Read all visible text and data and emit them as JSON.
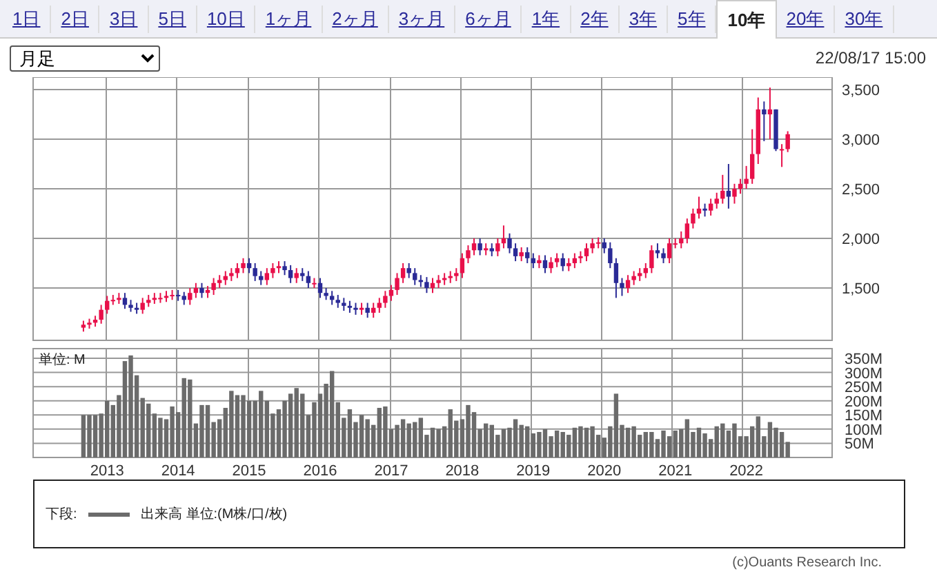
{
  "tabs": [
    {
      "label": "1日",
      "selected": false
    },
    {
      "label": "2日",
      "selected": false
    },
    {
      "label": "3日",
      "selected": false
    },
    {
      "label": "5日",
      "selected": false
    },
    {
      "label": "10日",
      "selected": false
    },
    {
      "label": "1ヶ月",
      "selected": false
    },
    {
      "label": "2ヶ月",
      "selected": false
    },
    {
      "label": "3ヶ月",
      "selected": false
    },
    {
      "label": "6ヶ月",
      "selected": false
    },
    {
      "label": "1年",
      "selected": false
    },
    {
      "label": "2年",
      "selected": false
    },
    {
      "label": "3年",
      "selected": false
    },
    {
      "label": "5年",
      "selected": false
    },
    {
      "label": "10年",
      "selected": true
    },
    {
      "label": "20年",
      "selected": false
    },
    {
      "label": "30年",
      "selected": false
    }
  ],
  "period_select": {
    "value": "月足"
  },
  "timestamp": "22/08/17 15:00",
  "price_chart": {
    "chart_data": {
      "type": "candlestick",
      "grid": true,
      "ylim": [
        972,
        3625
      ],
      "yticks": [
        {
          "value": 1500,
          "label": "1,500"
        },
        {
          "value": 2000,
          "label": "2,000"
        },
        {
          "value": 2500,
          "label": "2,500"
        },
        {
          "value": 3000,
          "label": "3,000"
        },
        {
          "value": 3500,
          "label": "3,500"
        }
      ],
      "categories": [
        null,
        null,
        null,
        null,
        null,
        null,
        null,
        null,
        null,
        null,
        null,
        null,
        null,
        null,
        null,
        null,
        null,
        null,
        null,
        null,
        null,
        null,
        null,
        null,
        null,
        null,
        null,
        null,
        null,
        null,
        null,
        null,
        null,
        null,
        null,
        null,
        null,
        null,
        null,
        null,
        null,
        null,
        null,
        null,
        null,
        null,
        null,
        null,
        null,
        null,
        null,
        null,
        null,
        null,
        null,
        null,
        null,
        null,
        null,
        null,
        null,
        null,
        null,
        null,
        null,
        null,
        null,
        null,
        null,
        null,
        null,
        null,
        null,
        null,
        null,
        null,
        null,
        null,
        null,
        null,
        null,
        null,
        null,
        null,
        null,
        null,
        null,
        null,
        null,
        null,
        null,
        null,
        null,
        null,
        null,
        null,
        null,
        null,
        null,
        null,
        null,
        null,
        null,
        null,
        null,
        null,
        null,
        null,
        null,
        null,
        null,
        null,
        null,
        null,
        null,
        null,
        null,
        null,
        null,
        null,
        null,
        null,
        null,
        null,
        null,
        null,
        null,
        null,
        null,
        null,
        null,
        null,
        null,
        null,
        null
      ],
      "ohlc": [
        null,
        null,
        null,
        null,
        null,
        null,
        null,
        null,
        [
          1100,
          1170,
          1060,
          1130
        ],
        [
          1130,
          1190,
          1090,
          1150
        ],
        [
          1150,
          1220,
          1110,
          1180
        ],
        [
          1180,
          1330,
          1140,
          1280
        ],
        [
          1280,
          1420,
          1240,
          1370
        ],
        [
          1370,
          1430,
          1330,
          1380
        ],
        [
          1380,
          1450,
          1340,
          1400
        ],
        [
          1400,
          1450,
          1290,
          1330
        ],
        [
          1330,
          1380,
          1260,
          1300
        ],
        [
          1300,
          1350,
          1240,
          1280
        ],
        [
          1280,
          1400,
          1240,
          1350
        ],
        [
          1350,
          1430,
          1310,
          1380
        ],
        [
          1380,
          1450,
          1340,
          1400
        ],
        [
          1400,
          1450,
          1350,
          1400
        ],
        [
          1400,
          1470,
          1360,
          1420
        ],
        [
          1420,
          1480,
          1380,
          1430
        ],
        [
          1430,
          1480,
          1370,
          1420
        ],
        [
          1420,
          1460,
          1330,
          1380
        ],
        [
          1380,
          1500,
          1330,
          1450
        ],
        [
          1450,
          1550,
          1400,
          1500
        ],
        [
          1500,
          1550,
          1400,
          1450
        ],
        [
          1450,
          1520,
          1400,
          1480
        ],
        [
          1480,
          1600,
          1430,
          1550
        ],
        [
          1550,
          1630,
          1500,
          1580
        ],
        [
          1580,
          1670,
          1530,
          1620
        ],
        [
          1620,
          1700,
          1570,
          1650
        ],
        [
          1650,
          1750,
          1600,
          1700
        ],
        [
          1700,
          1800,
          1650,
          1750
        ],
        [
          1750,
          1800,
          1650,
          1700
        ],
        [
          1700,
          1750,
          1570,
          1620
        ],
        [
          1620,
          1670,
          1530,
          1580
        ],
        [
          1580,
          1700,
          1530,
          1650
        ],
        [
          1650,
          1750,
          1600,
          1700
        ],
        [
          1700,
          1770,
          1650,
          1720
        ],
        [
          1720,
          1770,
          1630,
          1680
        ],
        [
          1680,
          1730,
          1550,
          1600
        ],
        [
          1600,
          1700,
          1550,
          1650
        ],
        [
          1650,
          1700,
          1570,
          1620
        ],
        [
          1620,
          1670,
          1500,
          1550
        ],
        [
          1550,
          1600,
          1500,
          1550
        ],
        [
          1550,
          1600,
          1400,
          1450
        ],
        [
          1450,
          1500,
          1380,
          1420
        ],
        [
          1420,
          1470,
          1330,
          1380
        ],
        [
          1380,
          1430,
          1300,
          1350
        ],
        [
          1350,
          1400,
          1270,
          1320
        ],
        [
          1320,
          1370,
          1250,
          1300
        ],
        [
          1300,
          1350,
          1230,
          1280
        ],
        [
          1280,
          1350,
          1230,
          1300
        ],
        [
          1300,
          1350,
          1200,
          1250
        ],
        [
          1250,
          1350,
          1200,
          1300
        ],
        [
          1300,
          1400,
          1250,
          1350
        ],
        [
          1350,
          1470,
          1300,
          1420
        ],
        [
          1420,
          1530,
          1370,
          1480
        ],
        [
          1480,
          1650,
          1430,
          1600
        ],
        [
          1600,
          1750,
          1550,
          1700
        ],
        [
          1700,
          1750,
          1600,
          1650
        ],
        [
          1650,
          1700,
          1530,
          1580
        ],
        [
          1580,
          1630,
          1510,
          1560
        ],
        [
          1560,
          1610,
          1450,
          1500
        ],
        [
          1500,
          1600,
          1450,
          1550
        ],
        [
          1550,
          1630,
          1500,
          1580
        ],
        [
          1580,
          1650,
          1530,
          1600
        ],
        [
          1600,
          1670,
          1550,
          1620
        ],
        [
          1620,
          1700,
          1570,
          1650
        ],
        [
          1650,
          1850,
          1600,
          1800
        ],
        [
          1800,
          1930,
          1750,
          1880
        ],
        [
          1880,
          2000,
          1830,
          1950
        ],
        [
          1950,
          2000,
          1830,
          1880
        ],
        [
          1880,
          1950,
          1830,
          1900
        ],
        [
          1900,
          1950,
          1820,
          1870
        ],
        [
          1870,
          2000,
          1820,
          1950
        ],
        [
          1950,
          2130,
          1900,
          2000
        ],
        [
          2000,
          2050,
          1850,
          1900
        ],
        [
          1900,
          1950,
          1770,
          1820
        ],
        [
          1820,
          1910,
          1770,
          1860
        ],
        [
          1860,
          1910,
          1750,
          1800
        ],
        [
          1800,
          1850,
          1700,
          1750
        ],
        [
          1750,
          1830,
          1700,
          1780
        ],
        [
          1780,
          1830,
          1650,
          1700
        ],
        [
          1700,
          1810,
          1650,
          1760
        ],
        [
          1760,
          1850,
          1710,
          1800
        ],
        [
          1800,
          1850,
          1670,
          1720
        ],
        [
          1720,
          1800,
          1670,
          1750
        ],
        [
          1750,
          1850,
          1700,
          1800
        ],
        [
          1800,
          1870,
          1750,
          1820
        ],
        [
          1820,
          1950,
          1770,
          1900
        ],
        [
          1900,
          2000,
          1850,
          1950
        ],
        [
          1950,
          2010,
          1900,
          1960
        ],
        [
          1960,
          2000,
          1850,
          1900
        ],
        [
          1900,
          1960,
          1700,
          1750
        ],
        [
          1750,
          1800,
          1400,
          1550
        ],
        [
          1550,
          1600,
          1420,
          1500
        ],
        [
          1500,
          1630,
          1450,
          1580
        ],
        [
          1580,
          1670,
          1530,
          1620
        ],
        [
          1620,
          1700,
          1570,
          1650
        ],
        [
          1650,
          1750,
          1600,
          1700
        ],
        [
          1700,
          1930,
          1650,
          1880
        ],
        [
          1880,
          1950,
          1800,
          1850
        ],
        [
          1850,
          1900,
          1750,
          1800
        ],
        [
          1800,
          2000,
          1750,
          1950
        ],
        [
          1950,
          2000,
          1900,
          1950
        ],
        [
          1950,
          2070,
          1900,
          2000
        ],
        [
          2000,
          2200,
          1950,
          2150
        ],
        [
          2150,
          2300,
          2100,
          2250
        ],
        [
          2250,
          2420,
          2200,
          2300
        ],
        [
          2300,
          2350,
          2220,
          2280
        ],
        [
          2280,
          2400,
          2230,
          2350
        ],
        [
          2350,
          2460,
          2300,
          2400
        ],
        [
          2400,
          2640,
          2350,
          2480
        ],
        [
          2480,
          2750,
          2300,
          2420
        ],
        [
          2420,
          2550,
          2350,
          2500
        ],
        [
          2500,
          2600,
          2450,
          2550
        ],
        [
          2550,
          2730,
          2500,
          2600
        ],
        [
          2600,
          3100,
          2550,
          2850
        ],
        [
          2850,
          3420,
          2750,
          3300
        ],
        [
          3300,
          3380,
          2980,
          3250
        ],
        [
          3250,
          3520,
          3000,
          3300
        ],
        [
          3300,
          3300,
          2880,
          2900
        ],
        [
          2900,
          2950,
          2720,
          2900
        ],
        [
          2900,
          3080,
          2870,
          3050
        ],
        null,
        null,
        null,
        null,
        null,
        null,
        null
      ]
    }
  },
  "volume_chart": {
    "unit_label": "単位: M",
    "chart_data": {
      "type": "bar",
      "grid": true,
      "ylim": [
        0,
        384
      ],
      "categories": [
        null,
        null,
        null,
        null,
        null,
        null,
        null,
        null,
        null,
        null,
        null,
        null,
        "2013",
        null,
        null,
        null,
        null,
        null,
        null,
        null,
        null,
        null,
        null,
        null,
        "2014",
        null,
        null,
        null,
        null,
        null,
        null,
        null,
        null,
        null,
        null,
        null,
        "2015",
        null,
        null,
        null,
        null,
        null,
        null,
        null,
        null,
        null,
        null,
        null,
        "2016",
        null,
        null,
        null,
        null,
        null,
        null,
        null,
        null,
        null,
        null,
        null,
        "2017",
        null,
        null,
        null,
        null,
        null,
        null,
        null,
        null,
        null,
        null,
        null,
        "2018",
        null,
        null,
        null,
        null,
        null,
        null,
        null,
        null,
        null,
        null,
        null,
        "2019",
        null,
        null,
        null,
        null,
        null,
        null,
        null,
        null,
        null,
        null,
        null,
        "2020",
        null,
        null,
        null,
        null,
        null,
        null,
        null,
        null,
        null,
        null,
        null,
        "2021",
        null,
        null,
        null,
        null,
        null,
        null,
        null,
        null,
        null,
        null,
        null,
        "2022",
        null,
        null,
        null,
        null,
        null,
        null,
        null,
        null,
        null,
        null,
        null,
        null,
        null,
        null
      ],
      "yticks": [
        {
          "value": 50,
          "label": "50M"
        },
        {
          "value": 100,
          "label": "100M"
        },
        {
          "value": 150,
          "label": "150M"
        },
        {
          "value": 200,
          "label": "200M"
        },
        {
          "value": 250,
          "label": "250M"
        },
        {
          "value": 300,
          "label": "300M"
        },
        {
          "value": 350,
          "label": "350M"
        }
      ],
      "series": [
        {
          "name": "出来高",
          "color": "#6b6b6b",
          "values": [
            null,
            null,
            null,
            null,
            null,
            null,
            null,
            null,
            150,
            150,
            150,
            155,
            200,
            185,
            220,
            340,
            360,
            290,
            210,
            190,
            155,
            140,
            135,
            180,
            160,
            280,
            275,
            120,
            185,
            185,
            125,
            135,
            175,
            235,
            220,
            220,
            200,
            200,
            235,
            200,
            155,
            170,
            200,
            225,
            245,
            225,
            150,
            195,
            225,
            260,
            305,
            195,
            140,
            170,
            125,
            150,
            135,
            115,
            175,
            180,
            100,
            115,
            135,
            120,
            125,
            140,
            80,
            105,
            100,
            110,
            170,
            130,
            135,
            185,
            160,
            100,
            120,
            115,
            80,
            100,
            105,
            135,
            115,
            110,
            85,
            90,
            100,
            75,
            95,
            90,
            80,
            105,
            110,
            105,
            110,
            80,
            70,
            110,
            225,
            115,
            105,
            110,
            80,
            90,
            90,
            65,
            95,
            75,
            95,
            100,
            135,
            90,
            105,
            85,
            65,
            110,
            120,
            95,
            120,
            75,
            75,
            110,
            145,
            75,
            125,
            105,
            90,
            55,
            null,
            null,
            null,
            null,
            null,
            null,
            null
          ]
        }
      ]
    }
  },
  "legend": {
    "prefix": "下段:",
    "unit": "単位:(M株/口/枚)"
  },
  "copyright": "(c)Ouants Research Inc."
}
